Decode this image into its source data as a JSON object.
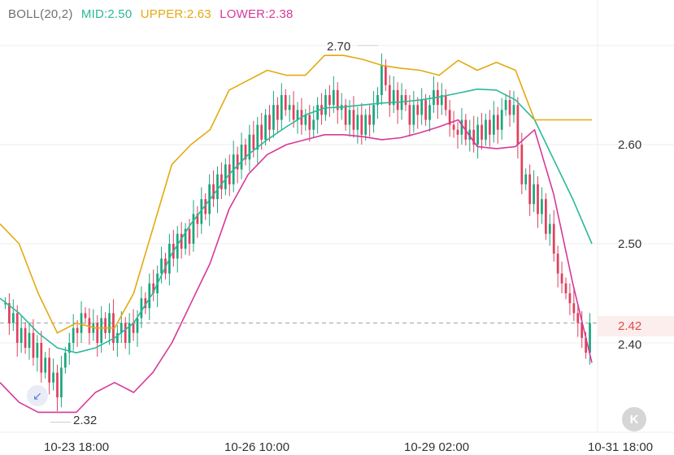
{
  "legend": {
    "indicator": "BOLL(20,2)",
    "mid": "MID:2.50",
    "upper": "UPPER:2.63",
    "lower": "LOWER:2.38"
  },
  "annotations": {
    "high": "2.70",
    "low": "2.32"
  },
  "last_price": "2.42",
  "buttons": {
    "collapse": "K",
    "zoom": "↙"
  },
  "colors": {
    "up": "#1aa77e",
    "down": "#e0405d",
    "mid": "#2bb89a",
    "upper": "#e3a90f",
    "lower": "#d6389a",
    "last_price": "#e24a4a",
    "grid": "#eeeeee"
  },
  "chart_data": {
    "type": "line",
    "title": "BOLL(20,2)",
    "yticks": [
      "2.60",
      "2.50",
      "2.40"
    ],
    "xticks": [
      "10-23 18:00",
      "10-26 10:00",
      "10-29 02:00",
      "10-31 18:00"
    ],
    "ylim": [
      2.3,
      2.75
    ],
    "grid": true,
    "last_price": 2.42,
    "high": 2.7,
    "low": 2.32,
    "series": [
      {
        "name": "MID",
        "values": [
          2.445,
          2.43,
          2.41,
          2.395,
          2.39,
          2.395,
          2.405,
          2.42,
          2.45,
          2.49,
          2.52,
          2.545,
          2.57,
          2.59,
          2.605,
          2.618,
          2.63,
          2.637,
          2.638,
          2.64,
          2.642,
          2.643,
          2.645,
          2.648,
          2.652,
          2.656,
          2.655,
          2.645,
          2.625,
          2.585,
          2.545,
          2.5
        ]
      },
      {
        "name": "UPPER",
        "values": [
          2.52,
          2.5,
          2.45,
          2.41,
          2.42,
          2.415,
          2.415,
          2.45,
          2.515,
          2.58,
          2.6,
          2.615,
          2.655,
          2.665,
          2.675,
          2.67,
          2.67,
          2.69,
          2.69,
          2.686,
          2.68,
          2.677,
          2.675,
          2.67,
          2.685,
          2.675,
          2.683,
          2.675,
          2.625,
          2.625,
          2.625,
          2.625
        ]
      },
      {
        "name": "LOWER",
        "values": [
          2.36,
          2.34,
          2.33,
          2.33,
          2.33,
          2.35,
          2.36,
          2.35,
          2.37,
          2.4,
          2.44,
          2.48,
          2.535,
          2.57,
          2.59,
          2.6,
          2.605,
          2.61,
          2.61,
          2.608,
          2.605,
          2.607,
          2.612,
          2.618,
          2.625,
          2.598,
          2.596,
          2.598,
          2.615,
          2.55,
          2.46,
          2.38
        ]
      }
    ],
    "candles": [
      [
        2.44,
        2.44
      ],
      [
        2.44,
        2.42
      ],
      [
        2.42,
        2.43
      ],
      [
        2.43,
        2.4
      ],
      [
        2.4,
        2.415
      ],
      [
        2.415,
        2.395
      ],
      [
        2.395,
        2.41
      ],
      [
        2.41,
        2.385
      ],
      [
        2.385,
        2.4
      ],
      [
        2.4,
        2.37
      ],
      [
        2.37,
        2.385
      ],
      [
        2.385,
        2.36
      ],
      [
        2.36,
        2.37
      ],
      [
        2.37,
        2.345
      ],
      [
        2.345,
        2.375
      ],
      [
        2.375,
        2.39
      ],
      [
        2.39,
        2.4
      ],
      [
        2.4,
        2.415
      ],
      [
        2.415,
        2.41
      ],
      [
        2.41,
        2.43
      ],
      [
        2.43,
        2.425
      ],
      [
        2.425,
        2.41
      ],
      [
        2.41,
        2.42
      ],
      [
        2.42,
        2.4
      ],
      [
        2.4,
        2.425
      ],
      [
        2.425,
        2.41
      ],
      [
        2.41,
        2.43
      ],
      [
        2.43,
        2.4
      ],
      [
        2.4,
        2.41
      ],
      [
        2.41,
        2.42
      ],
      [
        2.42,
        2.4
      ],
      [
        2.4,
        2.42
      ],
      [
        2.42,
        2.41
      ],
      [
        2.41,
        2.425
      ],
      [
        2.425,
        2.445
      ],
      [
        2.445,
        2.435
      ],
      [
        2.435,
        2.46
      ],
      [
        2.46,
        2.45
      ],
      [
        2.45,
        2.47
      ],
      [
        2.47,
        2.485
      ],
      [
        2.485,
        2.47
      ],
      [
        2.47,
        2.5
      ],
      [
        2.5,
        2.485
      ],
      [
        2.485,
        2.51
      ],
      [
        2.51,
        2.495
      ],
      [
        2.495,
        2.515
      ],
      [
        2.515,
        2.5
      ],
      [
        2.5,
        2.53
      ],
      [
        2.53,
        2.52
      ],
      [
        2.52,
        2.545
      ],
      [
        2.545,
        2.53
      ],
      [
        2.53,
        2.56
      ],
      [
        2.56,
        2.545
      ],
      [
        2.545,
        2.57
      ],
      [
        2.57,
        2.555
      ],
      [
        2.555,
        2.58
      ],
      [
        2.58,
        2.56
      ],
      [
        2.56,
        2.59
      ],
      [
        2.59,
        2.575
      ],
      [
        2.575,
        2.6
      ],
      [
        2.6,
        2.585
      ],
      [
        2.585,
        2.61
      ],
      [
        2.61,
        2.595
      ],
      [
        2.595,
        2.62
      ],
      [
        2.62,
        2.605
      ],
      [
        2.605,
        2.63
      ],
      [
        2.63,
        2.615
      ],
      [
        2.615,
        2.64
      ],
      [
        2.64,
        2.625
      ],
      [
        2.625,
        2.65
      ],
      [
        2.65,
        2.635
      ],
      [
        2.635,
        2.64
      ],
      [
        2.64,
        2.625
      ],
      [
        2.625,
        2.635
      ],
      [
        2.635,
        2.62
      ],
      [
        2.62,
        2.63
      ],
      [
        2.63,
        2.615
      ],
      [
        2.615,
        2.625
      ],
      [
        2.625,
        2.64
      ],
      [
        2.64,
        2.63
      ],
      [
        2.63,
        2.65
      ],
      [
        2.65,
        2.64
      ],
      [
        2.64,
        2.655
      ],
      [
        2.655,
        2.635
      ],
      [
        2.635,
        2.64
      ],
      [
        2.64,
        2.62
      ],
      [
        2.62,
        2.635
      ],
      [
        2.635,
        2.615
      ],
      [
        2.615,
        2.63
      ],
      [
        2.63,
        2.61
      ],
      [
        2.61,
        2.63
      ],
      [
        2.63,
        2.62
      ],
      [
        2.62,
        2.64
      ],
      [
        2.64,
        2.65
      ],
      [
        2.65,
        2.68
      ],
      [
        2.68,
        2.66
      ],
      [
        2.66,
        2.64
      ],
      [
        2.64,
        2.655
      ],
      [
        2.655,
        2.635
      ],
      [
        2.635,
        2.65
      ],
      [
        2.65,
        2.64
      ],
      [
        2.64,
        2.62
      ],
      [
        2.62,
        2.64
      ],
      [
        2.64,
        2.63
      ],
      [
        2.63,
        2.645
      ],
      [
        2.645,
        2.625
      ],
      [
        2.625,
        2.64
      ],
      [
        2.64,
        2.655
      ],
      [
        2.655,
        2.64
      ],
      [
        2.64,
        2.65
      ],
      [
        2.65,
        2.635
      ],
      [
        2.635,
        2.62
      ],
      [
        2.62,
        2.615
      ],
      [
        2.615,
        2.61
      ],
      [
        2.61,
        2.625
      ],
      [
        2.625,
        2.605
      ],
      [
        2.605,
        2.615
      ],
      [
        2.615,
        2.6
      ],
      [
        2.6,
        2.62
      ],
      [
        2.62,
        2.605
      ],
      [
        2.605,
        2.625
      ],
      [
        2.625,
        2.61
      ],
      [
        2.61,
        2.63
      ],
      [
        2.63,
        2.615
      ],
      [
        2.615,
        2.635
      ],
      [
        2.635,
        2.645
      ],
      [
        2.645,
        2.63
      ],
      [
        2.63,
        2.64
      ],
      [
        2.64,
        2.6
      ],
      [
        2.6,
        2.56
      ],
      [
        2.56,
        2.57
      ],
      [
        2.57,
        2.54
      ],
      [
        2.54,
        2.56
      ],
      [
        2.56,
        2.53
      ],
      [
        2.53,
        2.545
      ],
      [
        2.545,
        2.51
      ],
      [
        2.51,
        2.52
      ],
      [
        2.52,
        2.49
      ],
      [
        2.49,
        2.47
      ],
      [
        2.47,
        2.46
      ],
      [
        2.46,
        2.45
      ],
      [
        2.45,
        2.44
      ],
      [
        2.44,
        2.43
      ],
      [
        2.43,
        2.42
      ],
      [
        2.42,
        2.405
      ],
      [
        2.405,
        2.39
      ],
      [
        2.39,
        2.42
      ]
    ]
  }
}
